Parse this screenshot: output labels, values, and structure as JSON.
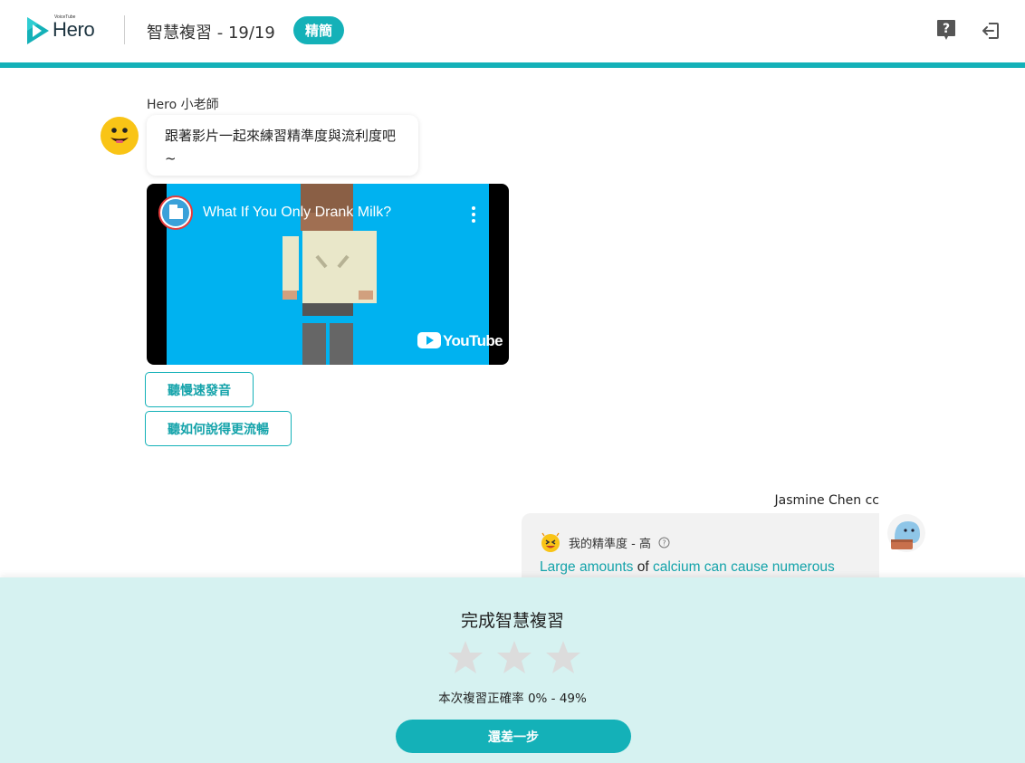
{
  "header": {
    "logo_small": "VoiceTube",
    "logo_text": "Hero",
    "title": "智慧複習 - 19/19",
    "badge": "精簡",
    "help_icon": "help-icon",
    "exit_icon": "exit-icon"
  },
  "chat": {
    "teacher": {
      "name": "Hero 小老師",
      "message": "跟著影片一起來練習精準度與流利度吧~",
      "avatar_icon": "smiley-icon"
    },
    "video": {
      "title": "What If You Only Drank Milk?",
      "platform": "YouTube"
    },
    "options": [
      {
        "label": "聽慢速發音"
      },
      {
        "label": "聽如何說得更流暢"
      }
    ],
    "user": {
      "name": "Jasmine Chen cc",
      "accuracy_label": "我的精準度 - 高",
      "sentence": {
        "part1": "Large amounts",
        "part2": " of ",
        "part3": "calcium can cause numerous"
      }
    }
  },
  "result_panel": {
    "title": "完成智慧複習",
    "stars_filled": 0,
    "stars_total": 3,
    "accuracy": "本次複習正確率 0% - 49%",
    "button": "還差一步"
  },
  "colors": {
    "accent": "#14b1b8",
    "panel_bg": "#d6f2f1",
    "star_empty": "#dcdcdc"
  }
}
